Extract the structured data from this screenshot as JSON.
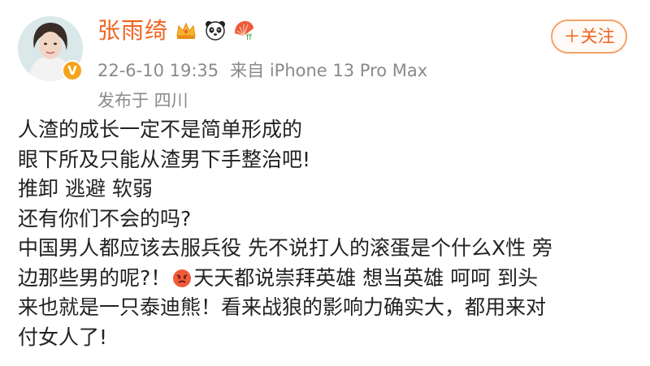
{
  "post": {
    "author": {
      "name": "张雨绮",
      "verified_color": "#f4a31b"
    },
    "badges": [
      "crown-icon",
      "panda-icon",
      "fan-icon"
    ],
    "meta": {
      "time": "22-6-10 19:35",
      "source": "来自 iPhone 13 Pro Max",
      "location": "发布于 四川"
    },
    "follow_label": "＋关注",
    "content": {
      "line1": "人渣的成长一定不是简单形成的",
      "line2": "眼下所及只能从渣男下手整治吧!",
      "line3": "推卸 逃避 软弱",
      "line4": "还有你们不会的吗?",
      "line5": "中国男人都应该去服兵役 先不说打人的滚蛋是个什么X性 旁",
      "line6a": "边那些男的呢?！",
      "line6b": "天天都说崇拜英雄 想当英雄 呵呵 到头",
      "line7": "来也就是一只泰迪熊！看来战狼的影响力确实大，都用来对",
      "line8": "付女人了!"
    }
  },
  "colors": {
    "name": "#f1631f",
    "meta": "#8a8a8a",
    "text": "#222222",
    "follow_border": "#f5a26a"
  }
}
